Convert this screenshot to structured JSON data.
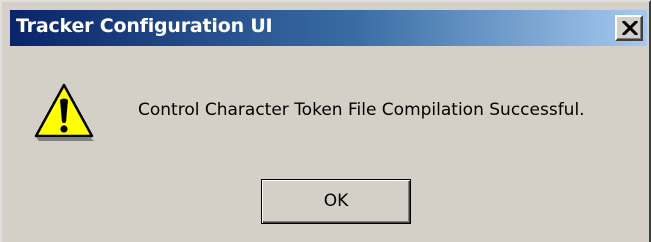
{
  "window": {
    "title": "Tracker Configuration UI",
    "close_icon": "close-icon"
  },
  "dialog": {
    "icon": "warning-icon",
    "message": "Control Character Token File Compilation Successful.",
    "ok_label": "OK"
  },
  "colors": {
    "titlebar_start": "#0a246a",
    "titlebar_end": "#a6caf0",
    "dialog_bg": "#d4d0c8",
    "warning_fill": "#ffff00"
  }
}
